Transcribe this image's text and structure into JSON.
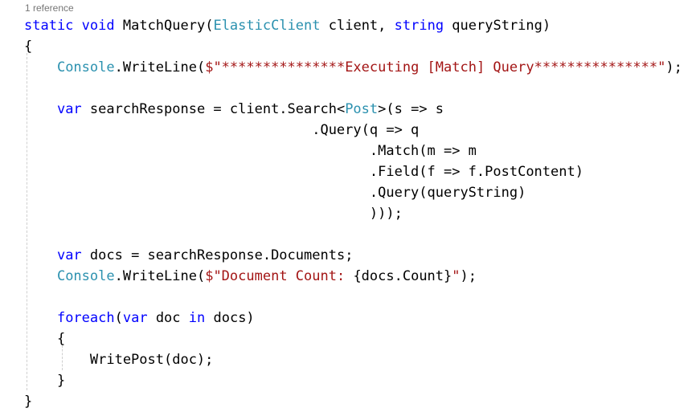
{
  "editor": {
    "codelens": "1 reference",
    "colors": {
      "keyword": "#0000ff",
      "type": "#2b91af",
      "string": "#a31515",
      "plain": "#000000",
      "codelens": "#767676",
      "guide": "#cfcfcf",
      "background": "#ffffff"
    },
    "language": "csharp",
    "lines": [
      {
        "segments": [
          {
            "t": "static",
            "c": "keyword"
          },
          {
            "t": " ",
            "c": "plain"
          },
          {
            "t": "void",
            "c": "keyword"
          },
          {
            "t": " MatchQuery(",
            "c": "plain"
          },
          {
            "t": "ElasticClient",
            "c": "type"
          },
          {
            "t": " client, ",
            "c": "plain"
          },
          {
            "t": "string",
            "c": "keyword"
          },
          {
            "t": " queryString)",
            "c": "plain"
          }
        ]
      },
      {
        "segments": [
          {
            "t": "{",
            "c": "plain"
          }
        ]
      },
      {
        "segments": [
          {
            "t": "    ",
            "c": "plain"
          },
          {
            "t": "Console",
            "c": "type"
          },
          {
            "t": ".WriteLine(",
            "c": "plain"
          },
          {
            "t": "$\"***************Executing [Match] Query***************\"",
            "c": "string"
          },
          {
            "t": ");",
            "c": "plain"
          }
        ]
      },
      {
        "segments": []
      },
      {
        "segments": [
          {
            "t": "    ",
            "c": "plain"
          },
          {
            "t": "var",
            "c": "keyword"
          },
          {
            "t": " searchResponse = client.Search<",
            "c": "plain"
          },
          {
            "t": "Post",
            "c": "type"
          },
          {
            "t": ">(s => s",
            "c": "plain"
          }
        ]
      },
      {
        "segments": [
          {
            "t": "                                   .Query(q => q",
            "c": "plain"
          }
        ]
      },
      {
        "segments": [
          {
            "t": "                                          .Match(m => m",
            "c": "plain"
          }
        ]
      },
      {
        "segments": [
          {
            "t": "                                          .Field(f => f.PostContent)",
            "c": "plain"
          }
        ]
      },
      {
        "segments": [
          {
            "t": "                                          .Query(queryString)",
            "c": "plain"
          }
        ]
      },
      {
        "segments": [
          {
            "t": "                                          )));",
            "c": "plain"
          }
        ]
      },
      {
        "segments": []
      },
      {
        "segments": [
          {
            "t": "    ",
            "c": "plain"
          },
          {
            "t": "var",
            "c": "keyword"
          },
          {
            "t": " docs = searchResponse.Documents;",
            "c": "plain"
          }
        ]
      },
      {
        "segments": [
          {
            "t": "    ",
            "c": "plain"
          },
          {
            "t": "Console",
            "c": "type"
          },
          {
            "t": ".WriteLine(",
            "c": "plain"
          },
          {
            "t": "$\"Document Count: ",
            "c": "string"
          },
          {
            "t": "{docs.Count}",
            "c": "plain"
          },
          {
            "t": "\"",
            "c": "string"
          },
          {
            "t": ");",
            "c": "plain"
          }
        ]
      },
      {
        "segments": []
      },
      {
        "segments": [
          {
            "t": "    ",
            "c": "plain"
          },
          {
            "t": "foreach",
            "c": "keyword"
          },
          {
            "t": "(",
            "c": "plain"
          },
          {
            "t": "var",
            "c": "keyword"
          },
          {
            "t": " doc ",
            "c": "plain"
          },
          {
            "t": "in",
            "c": "keyword"
          },
          {
            "t": " docs)",
            "c": "plain"
          }
        ]
      },
      {
        "segments": [
          {
            "t": "    {",
            "c": "plain"
          }
        ]
      },
      {
        "segments": [
          {
            "t": "        WritePost(doc);",
            "c": "plain"
          }
        ]
      },
      {
        "segments": [
          {
            "t": "    }",
            "c": "plain"
          }
        ]
      },
      {
        "segments": [
          {
            "t": "}",
            "c": "plain"
          }
        ]
      }
    ]
  }
}
